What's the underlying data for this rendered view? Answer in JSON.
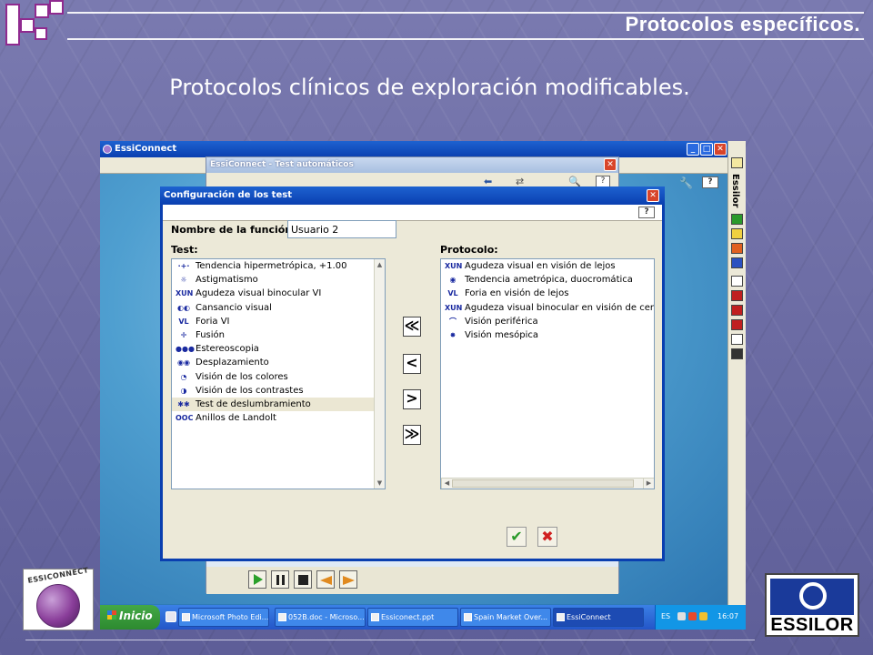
{
  "slide": {
    "title": "Protocolos específicos.",
    "subtitle": "Protocolos clínicos de exploración modificables."
  },
  "logos": {
    "left_text": "ESSICONNECT",
    "right_text": "ESSILOR"
  },
  "app": {
    "title": "EssiConnect",
    "right_toolbar_label": "Essilor"
  },
  "window2": {
    "title": "EssiConnect - Test automáticos"
  },
  "dialog": {
    "title": "Configuración de los test",
    "name_label": "Nombre de la función:",
    "name_value": "Usuario 2",
    "test_label": "Test:",
    "protocol_label": "Protocolo:",
    "tests": [
      {
        "label": "Tendencia hipermetrópica, +1.00",
        "icon": "hyperopia-icon"
      },
      {
        "label": "Astigmatismo",
        "icon": "astigmatism-icon"
      },
      {
        "label": "Agudeza visual binocular VI",
        "icon": "letters-icon"
      },
      {
        "label": "Cansancio visual",
        "icon": "fatigue-icon"
      },
      {
        "label": "Foria VI",
        "icon": "phoria-icon"
      },
      {
        "label": "Fusión",
        "icon": "fusion-icon"
      },
      {
        "label": "Estereoscopia",
        "icon": "stereo-icon"
      },
      {
        "label": "Desplazamiento",
        "icon": "displacement-icon"
      },
      {
        "label": "Visión de los colores",
        "icon": "color-vision-icon"
      },
      {
        "label": "Visión de los contrastes",
        "icon": "contrast-icon"
      },
      {
        "label": "Test de deslumbramiento",
        "icon": "glare-icon"
      },
      {
        "label": "Anillos de Landolt",
        "icon": "landolt-icon"
      }
    ],
    "selected_test_index": 10,
    "protocol": [
      {
        "label": "Agudeza visual en visión de lejos",
        "icon": "letters-icon"
      },
      {
        "label": "Tendencia ametrópica, duocromática",
        "icon": "duochrome-icon"
      },
      {
        "label": "Foria en visión de lejos",
        "icon": "phoria-icon"
      },
      {
        "label": "Agudeza visual binocular en visión de cerc",
        "icon": "letters-icon"
      },
      {
        "label": "Visión periférica",
        "icon": "peripheral-icon"
      },
      {
        "label": "Visión mesópica",
        "icon": "mesopic-icon"
      }
    ],
    "buttons": {
      "add_all": "≪",
      "add": "<",
      "remove": ">",
      "remove_all": "≫",
      "ok": "✔",
      "cancel": "✖",
      "help": "?"
    }
  },
  "taskbar": {
    "start": "Inicio",
    "tasks": [
      {
        "label": "Microsoft Photo Edi..."
      },
      {
        "label": "052B.doc - Microso..."
      },
      {
        "label": "Essiconect.ppt"
      },
      {
        "label": "Spain Market Over..."
      },
      {
        "label": "EssiConnect"
      }
    ],
    "active_task_index": 4,
    "language": "ES",
    "clock": "16:07"
  }
}
